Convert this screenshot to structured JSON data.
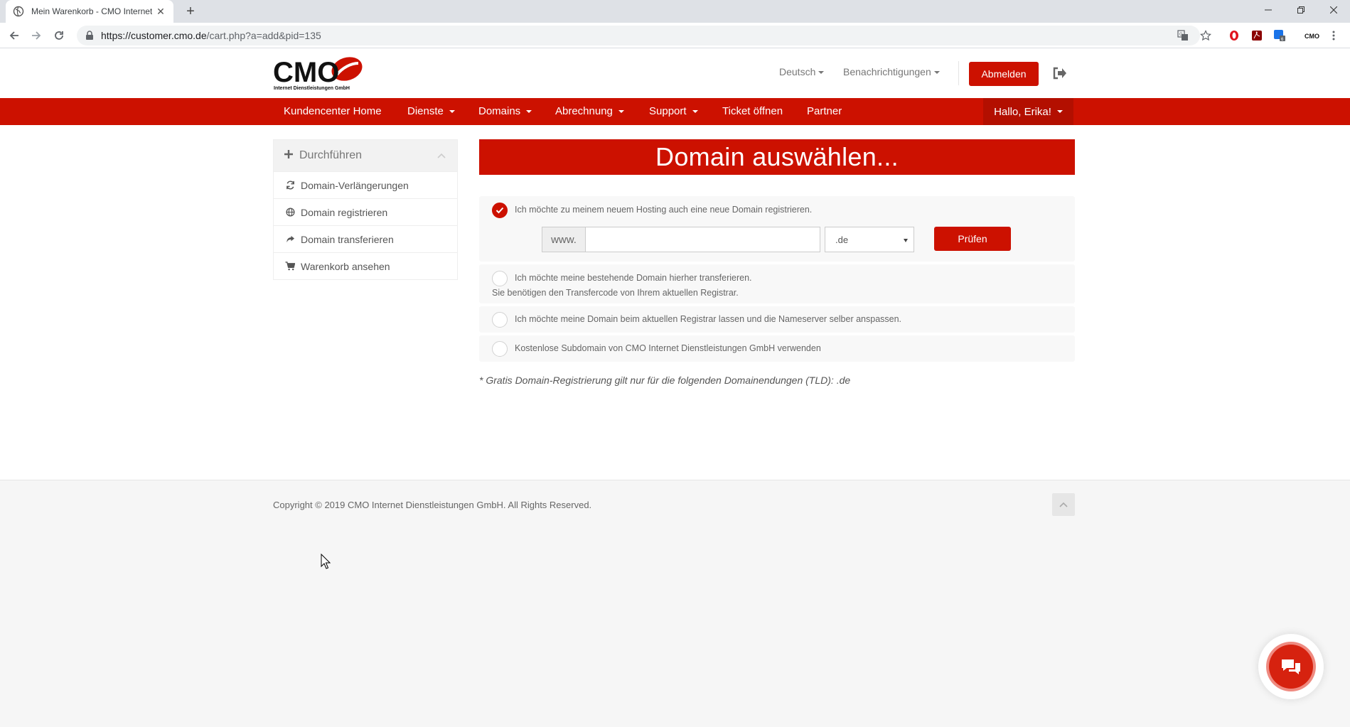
{
  "browser": {
    "tab_title": "Mein Warenkorb - CMO Internet",
    "url_main": "https://customer.cmo.de",
    "url_path": "/cart.php?a=add&pid=135"
  },
  "header": {
    "logo_text": "CMO",
    "logo_subtext": "Internet Dienstleistungen GmbH",
    "language_label": "Deutsch",
    "notifications_label": "Benachrichtigungen",
    "logout_label": "Abmelden"
  },
  "mainnav": {
    "items": [
      {
        "label": "Kundencenter Home"
      },
      {
        "label": "Dienste"
      },
      {
        "label": "Domains"
      },
      {
        "label": "Abrechnung"
      },
      {
        "label": "Support"
      },
      {
        "label": "Ticket öffnen"
      },
      {
        "label": "Partner"
      }
    ],
    "user_greeting": "Hallo, Erika!"
  },
  "sidebar": {
    "title": "Durchführen",
    "items": [
      {
        "label": "Domain-Verlängerungen",
        "icon": "refresh-icon"
      },
      {
        "label": "Domain registrieren",
        "icon": "globe-icon"
      },
      {
        "label": "Domain transferieren",
        "icon": "share-arrow-icon"
      },
      {
        "label": "Warenkorb ansehen",
        "icon": "cart-icon"
      }
    ]
  },
  "main": {
    "title": "Domain auswählen...",
    "options": [
      {
        "label": "Ich möchte zu meinem neuem Hosting auch eine neue Domain registrieren.",
        "checked": true
      },
      {
        "label": "Ich möchte meine bestehende Domain hierher transferieren.",
        "sub": "Sie benötigen den Transfercode von Ihrem aktuellen Registrar.",
        "checked": false
      },
      {
        "label": "Ich möchte meine Domain beim aktuellen Registrar lassen und die Nameserver selber anspassen.",
        "checked": false
      },
      {
        "label": "Kostenlose Subdomain von CMO Internet Dienstleistungen GmbH verwenden",
        "checked": false
      }
    ],
    "domain_prefix": "www.",
    "domain_value": "",
    "tld_selected": ".de",
    "check_button": "Prüfen",
    "footnote": "* Gratis Domain-Registrierung gilt nur für die folgenden Domainendungen (TLD): .de"
  },
  "footer": {
    "copyright": "Copyright © 2019 CMO Internet Dienstleistungen GmbH. All Rights Reserved."
  },
  "colors": {
    "brand_red": "#cc1100",
    "brand_red_dark": "#b30f00"
  }
}
